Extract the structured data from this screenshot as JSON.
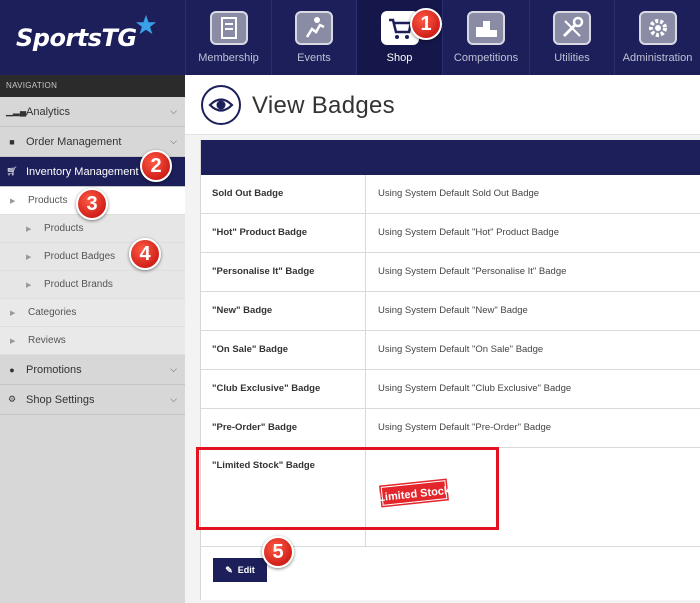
{
  "app": {
    "brand": "SportsTG"
  },
  "top_nav": [
    {
      "label": "Membership",
      "icon": "membership-icon"
    },
    {
      "label": "Events",
      "icon": "events-icon"
    },
    {
      "label": "Shop",
      "icon": "shop-cart-icon",
      "active": true
    },
    {
      "label": "Competitions",
      "icon": "competitions-icon"
    },
    {
      "label": "Utilities",
      "icon": "utilities-icon"
    },
    {
      "label": "Administration",
      "icon": "administration-icon"
    }
  ],
  "sidebar": {
    "heading": "NAVIGATION",
    "items": [
      {
        "label": "Analytics",
        "icon": "chart-icon"
      },
      {
        "label": "Order Management",
        "icon": "truck-icon"
      },
      {
        "label": "Inventory Management",
        "icon": "cart-icon",
        "selected": true
      },
      {
        "label": "Products"
      },
      {
        "label": "Products"
      },
      {
        "label": "Product Badges"
      },
      {
        "label": "Product Brands"
      },
      {
        "label": "Categories"
      },
      {
        "label": "Reviews"
      },
      {
        "label": "Promotions",
        "icon": "tag-icon"
      },
      {
        "label": "Shop Settings",
        "icon": "gears-icon"
      }
    ]
  },
  "page": {
    "title": "View Badges",
    "icon": "eye-icon"
  },
  "badges": [
    {
      "name": "Sold Out Badge",
      "value": "Using System Default Sold Out Badge"
    },
    {
      "name": "\"Hot\" Product Badge",
      "value": "Using System Default \"Hot\" Product Badge"
    },
    {
      "name": "\"Personalise It\" Badge",
      "value": "Using System Default \"Personalise It\" Badge"
    },
    {
      "name": "\"New\" Badge",
      "value": "Using System Default \"New\" Badge"
    },
    {
      "name": "\"On Sale\" Badge",
      "value": "Using System Default \"On Sale\" Badge"
    },
    {
      "name": "\"Club Exclusive\" Badge",
      "value": "Using System Default \"Club Exclusive\" Badge"
    },
    {
      "name": "\"Pre-Order\" Badge",
      "value": "Using System Default \"Pre-Order\" Badge"
    },
    {
      "name": "\"Limited Stock\" Badge",
      "image_text": "Limited Stock"
    }
  ],
  "edit_label": "Edit",
  "annotations": [
    "1",
    "2",
    "3",
    "4",
    "5"
  ],
  "colors": {
    "navy": "#1d1f5a",
    "annotation_red": "#e3121f"
  }
}
